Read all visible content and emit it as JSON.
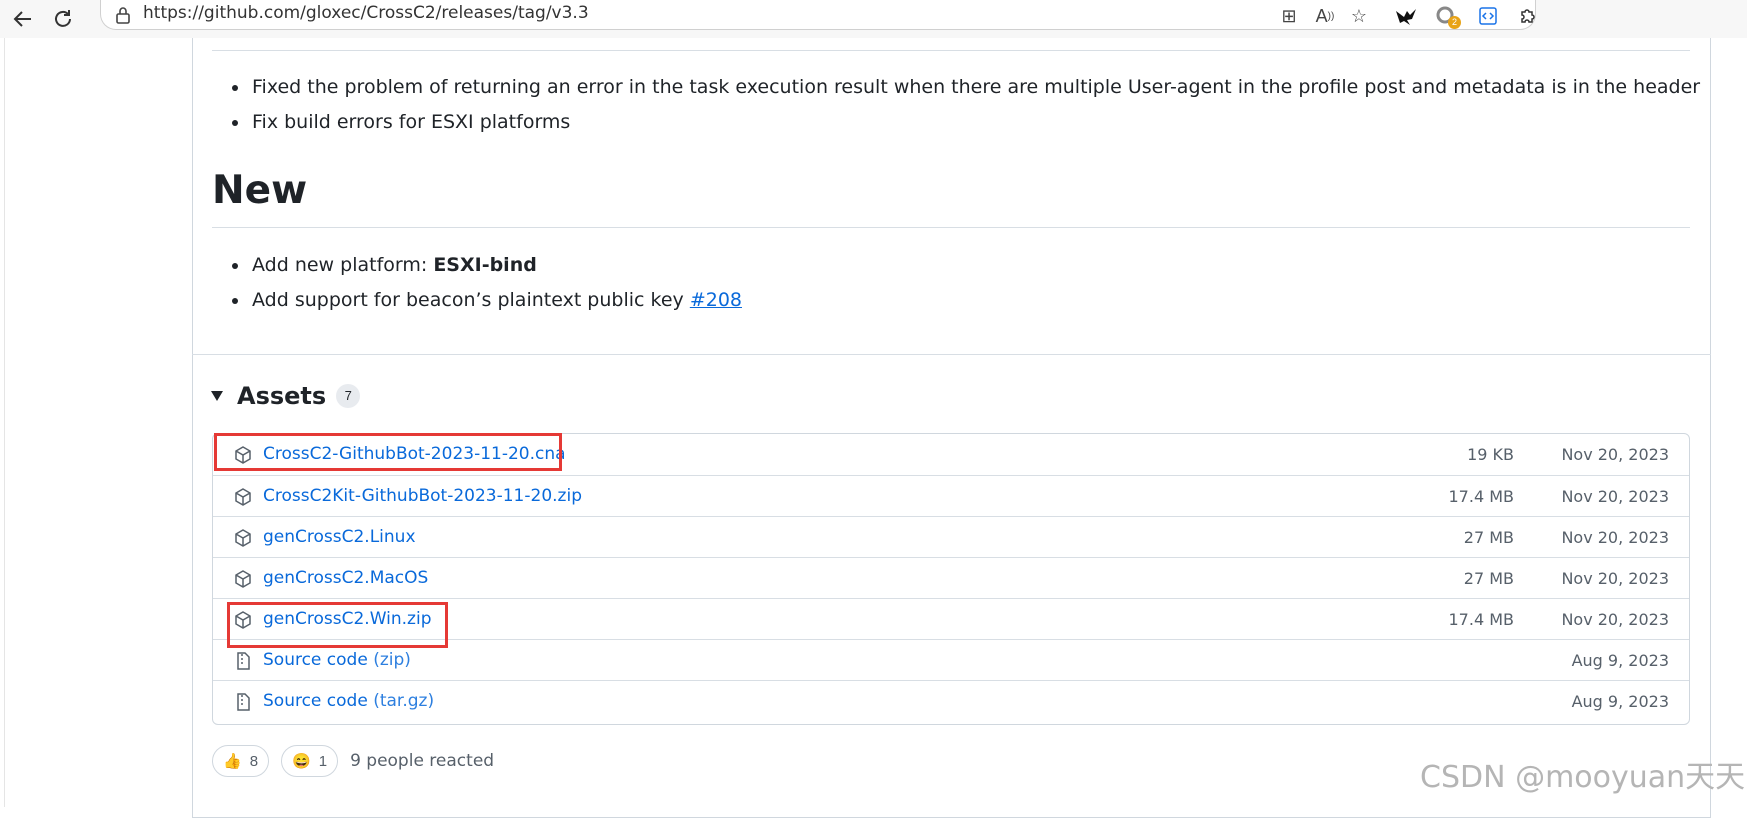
{
  "browser": {
    "url": "https://github.com/gloxec/CrossC2/releases/tag/v3.3",
    "extension_badge": "2"
  },
  "fixes": {
    "items": [
      "Fixed the problem of returning an error in the task execution result when there are multiple User-agent in the profile post and metadata is in the header",
      "Fix build errors for ESXI platforms"
    ]
  },
  "new_section": {
    "heading": "New",
    "item1_prefix": "Add new platform: ",
    "item1_strong": "ESXI-bind",
    "item2_prefix": "Add support for beacon’s plaintext public key ",
    "item2_link": "#208"
  },
  "assets": {
    "title": "Assets",
    "count": "7",
    "rows": [
      {
        "name": "CrossC2-GithubBot-2023-11-20.cna",
        "size": "19 KB",
        "date": "Nov 20, 2023",
        "icon": "package-icon",
        "highlighted": true
      },
      {
        "name": "CrossC2Kit-GithubBot-2023-11-20.zip",
        "size": "17.4 MB",
        "date": "Nov 20, 2023",
        "icon": "package-icon",
        "highlighted": false
      },
      {
        "name": "genCrossC2.Linux",
        "size": "27 MB",
        "date": "Nov 20, 2023",
        "icon": "package-icon",
        "highlighted": false
      },
      {
        "name": "genCrossC2.MacOS",
        "size": "27 MB",
        "date": "Nov 20, 2023",
        "icon": "package-icon",
        "highlighted": false
      },
      {
        "name": "genCrossC2.Win.zip",
        "size": "17.4 MB",
        "date": "Nov 20, 2023",
        "icon": "package-icon",
        "highlighted": true
      },
      {
        "name": "Source code",
        "ext": "(zip)",
        "size": "",
        "date": "Aug 9, 2023",
        "icon": "file-zip-icon",
        "highlighted": false
      },
      {
        "name": "Source code",
        "ext": "(tar.gz)",
        "size": "",
        "date": "Aug 9, 2023",
        "icon": "file-zip-icon",
        "highlighted": false
      }
    ]
  },
  "reactions": {
    "thumbs_up_count": "8",
    "laugh_count": "1",
    "summary": "9 people reacted"
  },
  "watermark": "CSDN @mooyuan天天",
  "colors": {
    "link": "#0969da",
    "highlight": "#e53935",
    "muted": "#57606a"
  }
}
